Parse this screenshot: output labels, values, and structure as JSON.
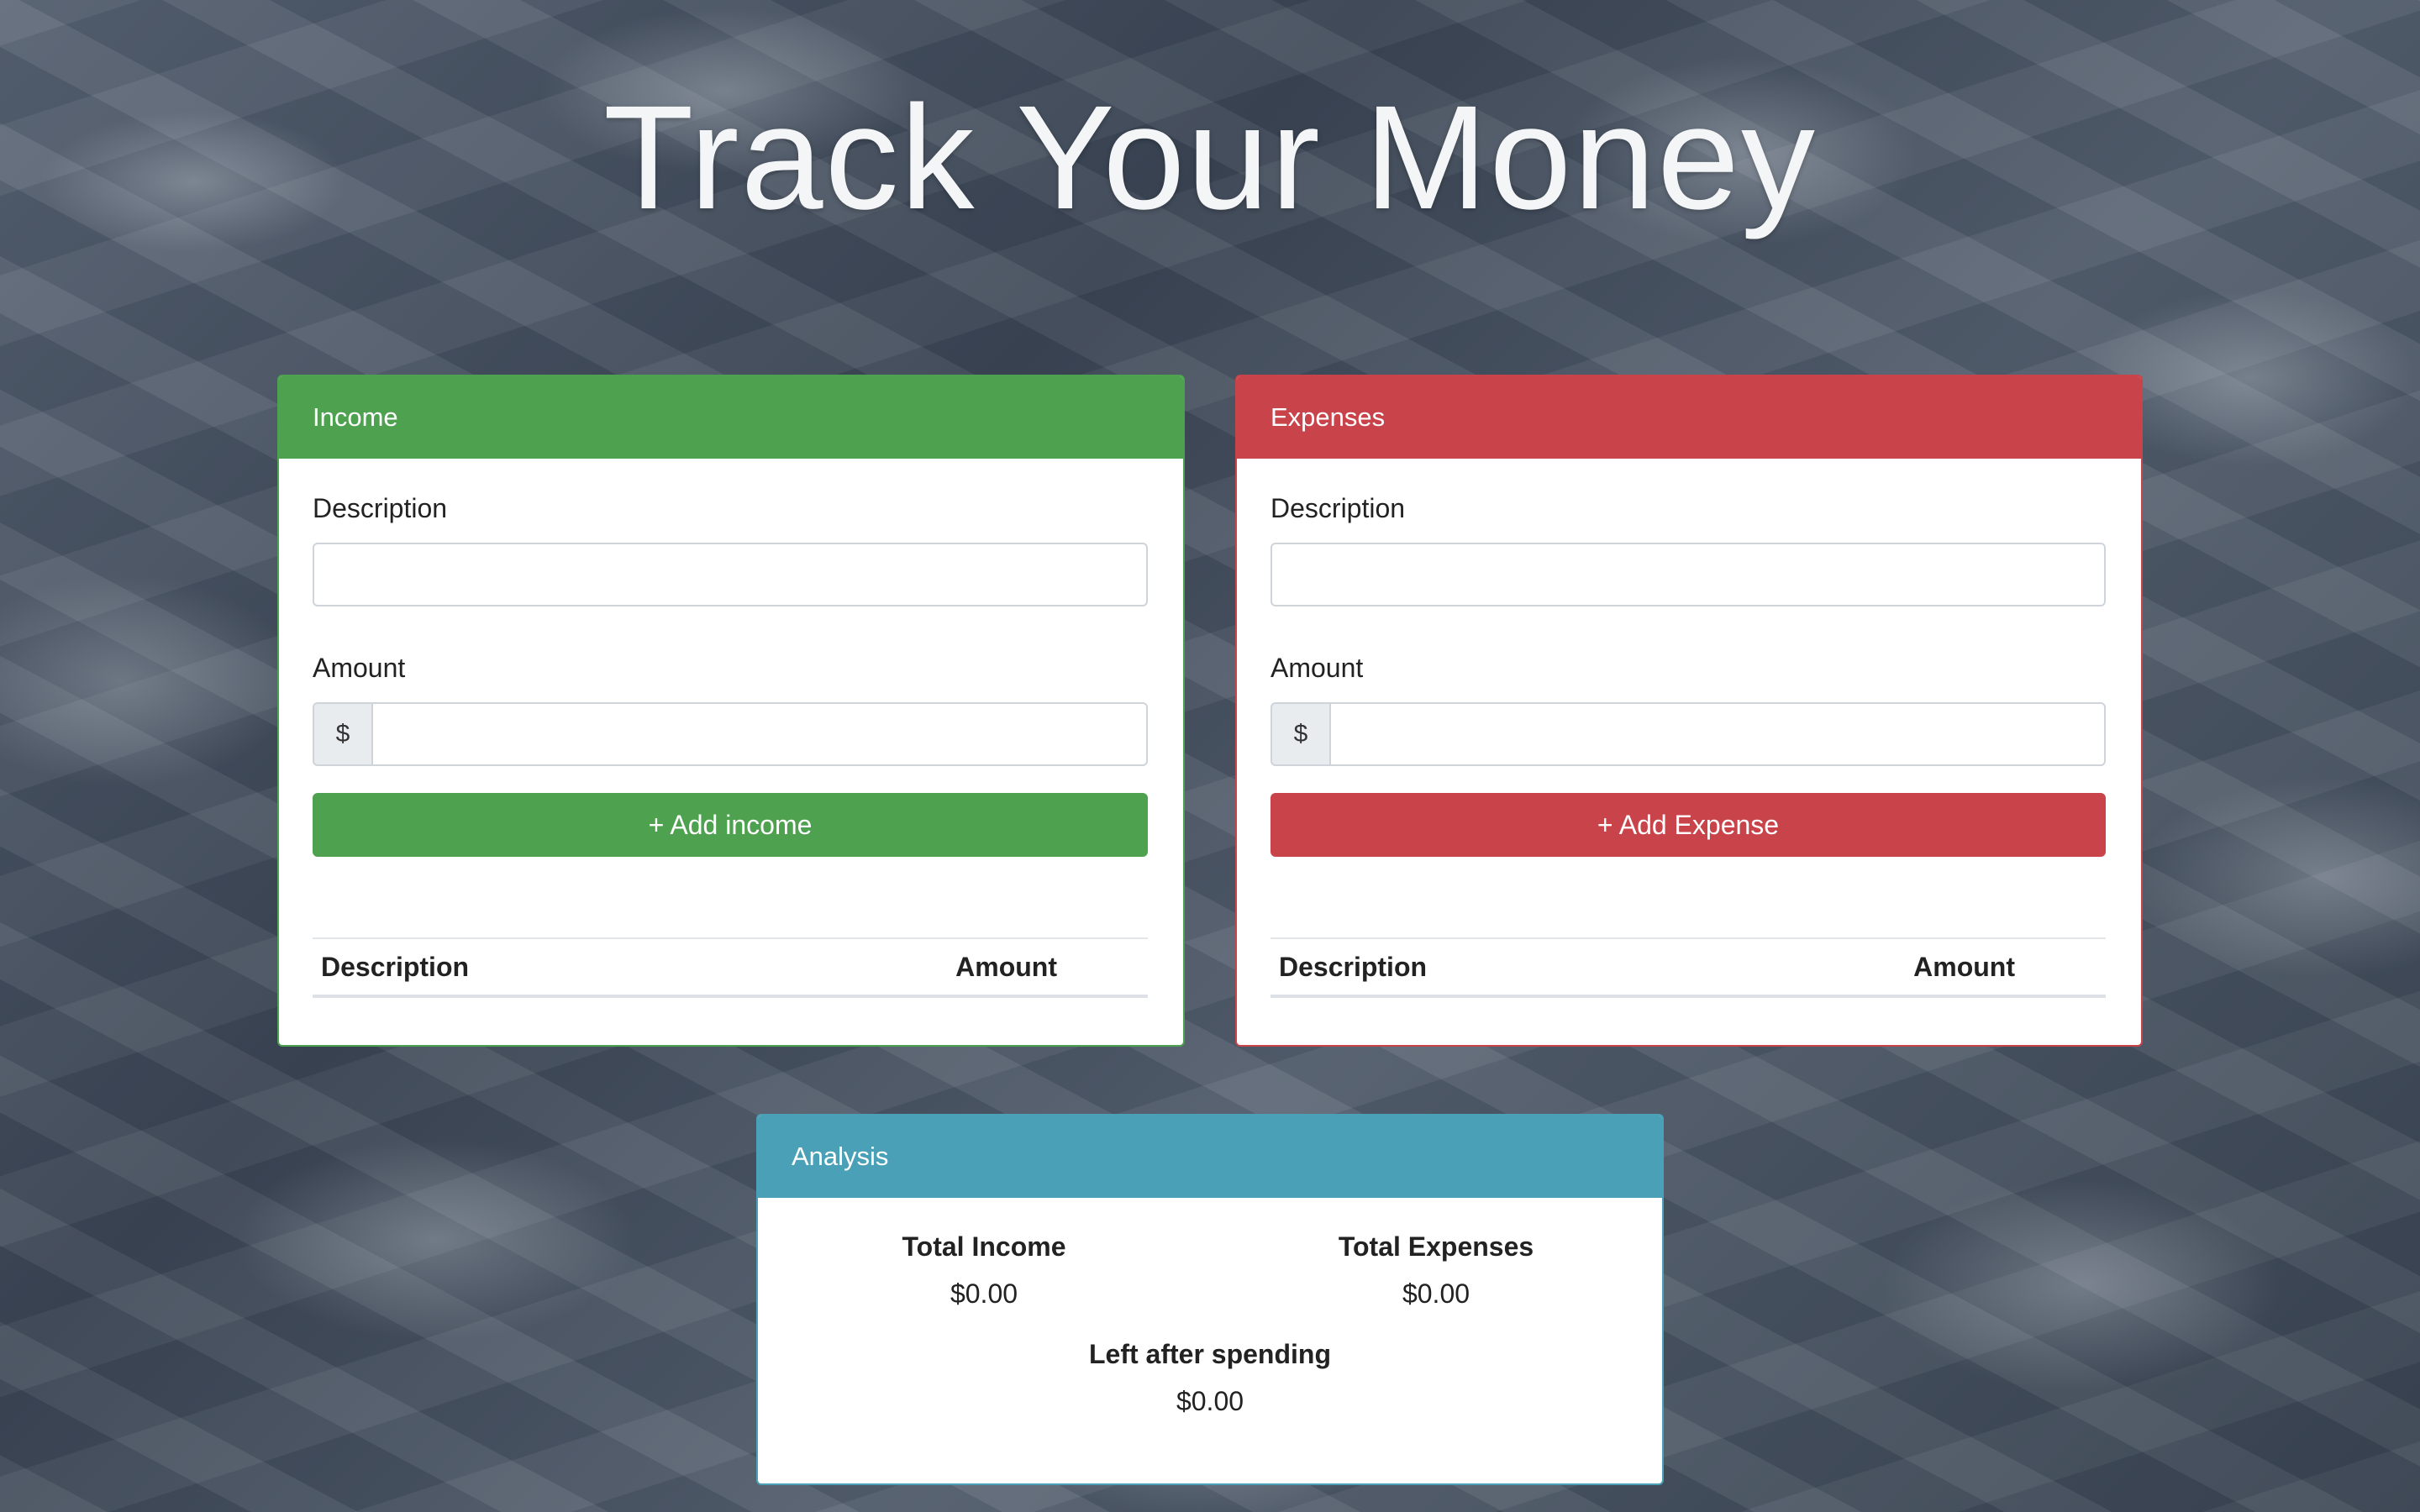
{
  "page": {
    "title": "Track Your Money"
  },
  "colors": {
    "income": "#4ea14f",
    "expenses": "#c9434a",
    "analysis": "#4aa0b6"
  },
  "income": {
    "header": "Income",
    "description_label": "Description",
    "description_value": "",
    "amount_label": "Amount",
    "amount_prefix": "$",
    "amount_value": "",
    "add_button": "+ Add income",
    "table": {
      "columns": [
        "Description",
        "Amount"
      ],
      "rows": []
    }
  },
  "expenses": {
    "header": "Expenses",
    "description_label": "Description",
    "description_value": "",
    "amount_label": "Amount",
    "amount_prefix": "$",
    "amount_value": "",
    "add_button": "+ Add Expense",
    "table": {
      "columns": [
        "Description",
        "Amount"
      ],
      "rows": []
    }
  },
  "analysis": {
    "header": "Analysis",
    "total_income_label": "Total Income",
    "total_income_value": "$0.00",
    "total_expenses_label": "Total Expenses",
    "total_expenses_value": "$0.00",
    "left_label": "Left after spending",
    "left_value": "$0.00"
  }
}
